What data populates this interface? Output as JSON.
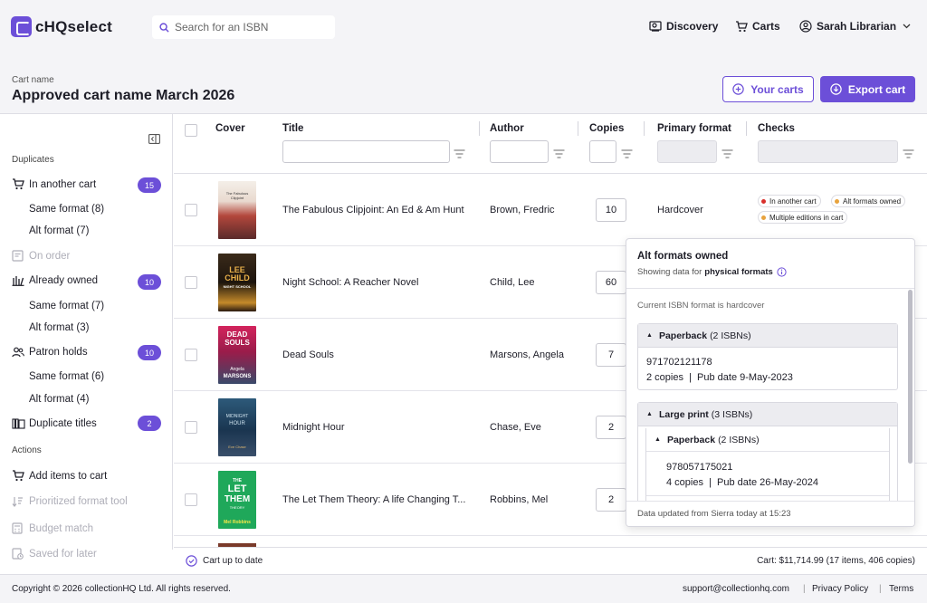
{
  "app": {
    "name": "cHQselect"
  },
  "search": {
    "placeholder": "Search for an ISBN"
  },
  "nav": {
    "discovery": "Discovery",
    "carts": "Carts",
    "user": "Sarah Librarian"
  },
  "header": {
    "cart_label": "Cart name",
    "cart_name": "Approved cart name March 2026",
    "your_carts": "Your carts",
    "export_cart": "Export cart"
  },
  "sidebar": {
    "duplicates_heading": "Duplicates",
    "in_another_cart": {
      "label": "In another cart",
      "count": "15"
    },
    "in_another_cart_same": "Same format (8)",
    "in_another_cart_alt": "Alt format (7)",
    "on_order": "On order",
    "already_owned": {
      "label": "Already owned",
      "count": "10"
    },
    "already_owned_same": "Same format (7)",
    "already_owned_alt": "Alt format (3)",
    "patron_holds": {
      "label": "Patron holds",
      "count": "10"
    },
    "patron_holds_same": "Same format (6)",
    "patron_holds_alt": "Alt format (4)",
    "duplicate_titles": {
      "label": "Duplicate titles",
      "count": "2"
    },
    "actions_heading": "Actions",
    "add_items": "Add items to cart",
    "prioritized": "Prioritized format tool",
    "budget_match": "Budget match",
    "saved_later": "Saved for later"
  },
  "table": {
    "headers": {
      "cover": "Cover",
      "title": "Title",
      "author": "Author",
      "copies": "Copies",
      "primary_format": "Primary format",
      "checks": "Checks"
    },
    "rows": [
      {
        "title": "The Fabulous Clipjoint: An Ed & Am Hunt",
        "author": "Brown, Fredric",
        "copies": "10",
        "format": "Hardcover",
        "checks": [
          "In another cart",
          "Alt formats owned",
          "Multiple editions in cart"
        ]
      },
      {
        "title": "Night School: A Reacher Novel",
        "author": "Child, Lee",
        "copies": "60"
      },
      {
        "title": "Dead Souls",
        "author": "Marsons, Angela",
        "copies": "7"
      },
      {
        "title": "Midnight Hour",
        "author": "Chase, Eve",
        "copies": "2"
      },
      {
        "title": "The Let Them Theory: A life Changing T...",
        "author": "Robbins, Mel",
        "copies": "2"
      }
    ]
  },
  "covers": {
    "c1_line1": "The Fabulous",
    "c1_line2": "Clipjoint",
    "c2_line1": "LEE",
    "c2_line2": "CHILD",
    "c2_line3": "NIGHT SCHOOL",
    "c3_line1": "DEAD",
    "c3_line2": "SOULS",
    "c3_line3": "Angela",
    "c3_line4": "MARSONS",
    "c4_line1": "MIDNIGHT",
    "c4_line2": "HOUR",
    "c4_line3": "Eve Chase",
    "c5_line1": "THE",
    "c5_line2": "LET",
    "c5_line3": "THEM",
    "c5_line4": "THEORY",
    "c5_line5": "Mel Robbins"
  },
  "popover": {
    "title": "Alt formats owned",
    "subtitle_prefix": "Showing data for",
    "subtitle_bold": "physical formats",
    "current_note": "Current ISBN format is hardcover",
    "group1": {
      "label": "Paperback",
      "count": "(2 ISBNs)",
      "isbn": "971702121178",
      "meta": "2 copies  |  Pub date 9-May-2023"
    },
    "group2": {
      "label": "Large print",
      "count": "(3 ISBNs)",
      "sub_label": "Paperback",
      "sub_count": "(2 ISBNs)",
      "isbn": "978057175021",
      "meta": "4 copies  |  Pub date 26-May-2024"
    },
    "footer": "Data updated from Sierra today at 15:23"
  },
  "status": {
    "up_to_date": "Cart up to date",
    "total": "Cart: $11,714.99 (17 items, 406 copies)"
  },
  "footer": {
    "copyright": "Copyright © 2026 collectionHQ Ltd. All rights reserved.",
    "support": "support@collectionhq.com",
    "privacy": "Privacy Policy",
    "terms": "Terms"
  },
  "colors": {
    "accent": "#6c4fd8",
    "dot_red": "#d9302c",
    "dot_orange": "#e8a33d"
  }
}
